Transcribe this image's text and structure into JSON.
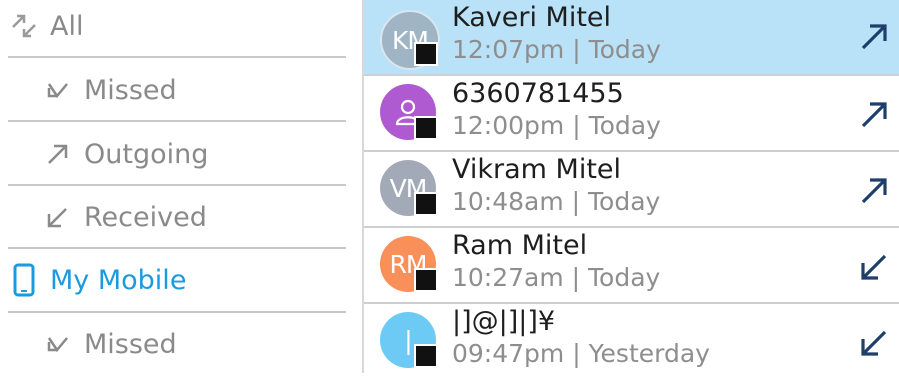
{
  "filters": [
    {
      "label": "All",
      "icon": "all-calls-icon",
      "active": false
    },
    {
      "label": "Missed",
      "icon": "missed-call-icon",
      "active": false
    },
    {
      "label": "Outgoing",
      "icon": "outgoing-call-icon",
      "active": false
    },
    {
      "label": "Received",
      "icon": "received-call-icon",
      "active": false
    },
    {
      "label": "My Mobile",
      "icon": "mobile-phone-icon",
      "active": true
    },
    {
      "label": "Missed",
      "icon": "missed-call-icon",
      "active": false
    }
  ],
  "calls": [
    {
      "initials": "KM",
      "name": "Kaveri Mitel",
      "time": "12:07pm | Today",
      "direction": "outgoing",
      "avatar_color": "#9fb4c4",
      "selected": true
    },
    {
      "initials": "",
      "name": "6360781455",
      "time": "12:00pm | Today",
      "direction": "outgoing",
      "avatar_color": "#b05ad1",
      "selected": false
    },
    {
      "initials": "VM",
      "name": "Vikram Mitel",
      "time": "10:48am | Today",
      "direction": "outgoing",
      "avatar_color": "#a2aab7",
      "selected": false
    },
    {
      "initials": "RM",
      "name": "Ram Mitel",
      "time": "10:27am | Today",
      "direction": "received",
      "avatar_color": "#f9905a",
      "selected": false
    },
    {
      "initials": "|",
      "name": "|]@|]|]¥",
      "time": "09:47pm | Yesterday",
      "direction": "received",
      "avatar_color": "#6ccaf5",
      "selected": false
    }
  ],
  "colors": {
    "accent": "#1a9be0",
    "selection": "#b9e1f7",
    "arrow": "#1f3f6b"
  }
}
